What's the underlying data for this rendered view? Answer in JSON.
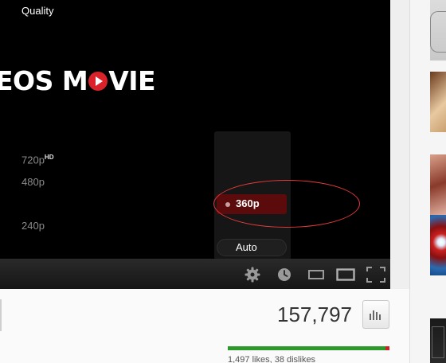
{
  "video": {
    "logo_text_left": "EOS M",
    "logo_text_right": "VIE"
  },
  "quality_menu": {
    "title": "Quality",
    "options": [
      {
        "label": "720p",
        "badge": "HD"
      },
      {
        "label": "480p"
      },
      {
        "label": "360p",
        "selected": true
      },
      {
        "label": "240p"
      },
      {
        "label": "Auto"
      }
    ]
  },
  "controls": {
    "icons": [
      "gear-icon",
      "watch-later-icon",
      "small-player-icon",
      "large-player-icon",
      "fullscreen-icon"
    ]
  },
  "stats": {
    "view_count": "157,797",
    "likes_text": "1,497 likes, 38 dislikes",
    "like_ratio": 0.975
  },
  "colors": {
    "accent_red": "#d9222a",
    "selected_bg": "#5b0b0b",
    "annotation_red": "#e23a3a",
    "likes_green": "#2b9a2b",
    "dislikes_red": "#cc2222"
  }
}
